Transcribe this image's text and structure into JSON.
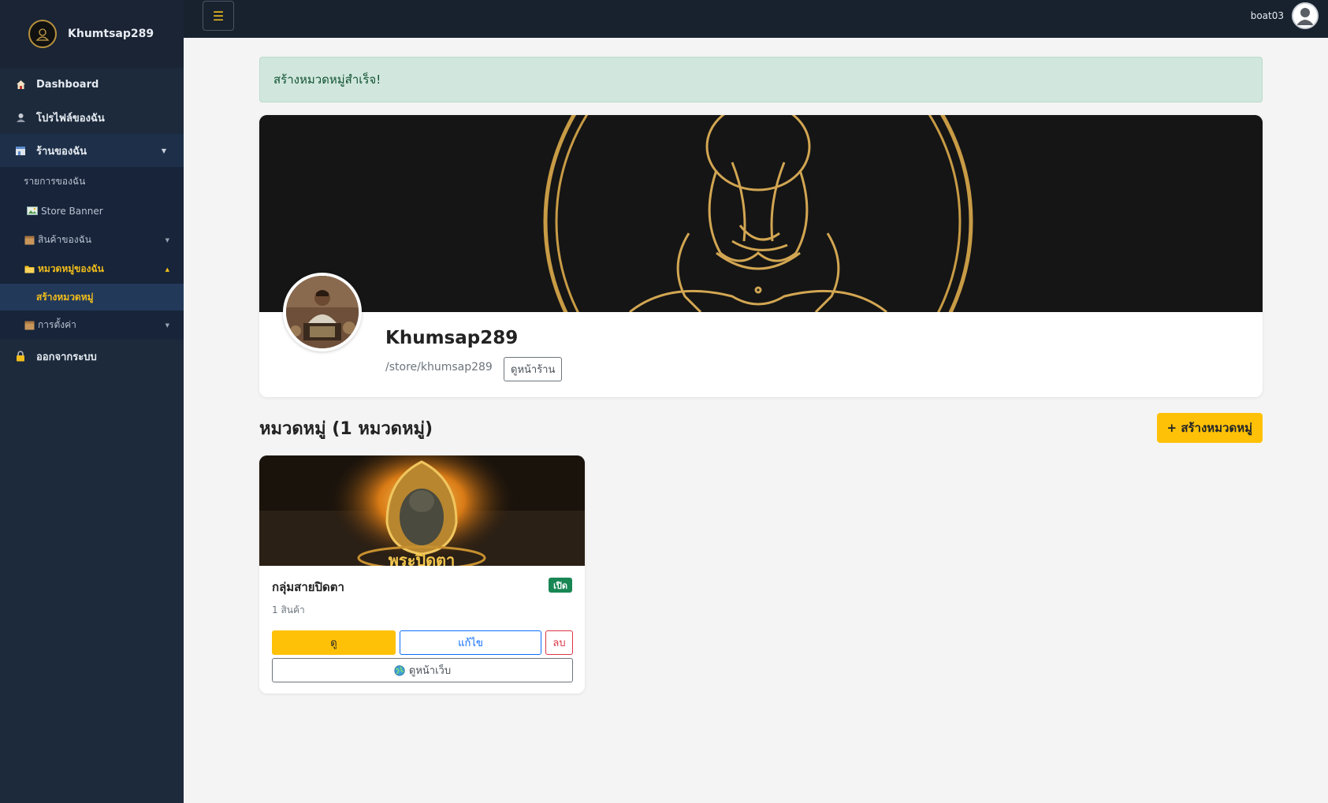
{
  "brand": {
    "name": "Khumtsap289"
  },
  "sidebar": {
    "items": [
      {
        "label": "Dashboard",
        "icon": "home-icon"
      },
      {
        "label": "โปรไฟล์ของฉัน",
        "icon": "user-icon"
      },
      {
        "label": "ร้านของฉัน",
        "icon": "store-icon"
      },
      {
        "label": "ออกจากระบบ",
        "icon": "lock-icon"
      }
    ],
    "store_sub": [
      {
        "label": "รายการของฉัน"
      },
      {
        "label": "Store Banner",
        "icon": "image-icon"
      },
      {
        "label": "สินค้าของฉัน",
        "icon": "box-icon"
      },
      {
        "label": "หมวดหมู่ของฉัน",
        "icon": "folder-icon"
      },
      {
        "label": "การตั้งค่า",
        "icon": "box-icon"
      }
    ],
    "category_sub": [
      {
        "label": "สร้างหมวดหมู่"
      }
    ]
  },
  "topbar": {
    "toggle": "☰",
    "username": "boat03"
  },
  "alert": {
    "message": "สร้างหมวดหมู่สำเร็จ!"
  },
  "store": {
    "name": "Khumsap289",
    "path": "/store/khumsap289",
    "view_store_label": "ดูหน้าร้าน"
  },
  "categories_section": {
    "title": "หมวดหมู่ (1 หมวดหมู่)",
    "create_label": "+ สร้างหมวดหมู่"
  },
  "categories": [
    {
      "name": "กลุ่มสายปิดตา",
      "status": "เปิด",
      "count": "1 สินค้า",
      "image_caption": "พระปิดตา",
      "view_label": "ดู",
      "edit_label": "แก้ไข",
      "delete_label": "ลบ",
      "web_label": "ดูหน้าเว็บ"
    }
  ],
  "colors": {
    "sidebar": "#1c2a3c",
    "topbar": "#18222f",
    "accent": "#f3be1b",
    "success_bg": "#d1e7dd",
    "primary": "#0d6efd",
    "danger": "#dc3545"
  }
}
